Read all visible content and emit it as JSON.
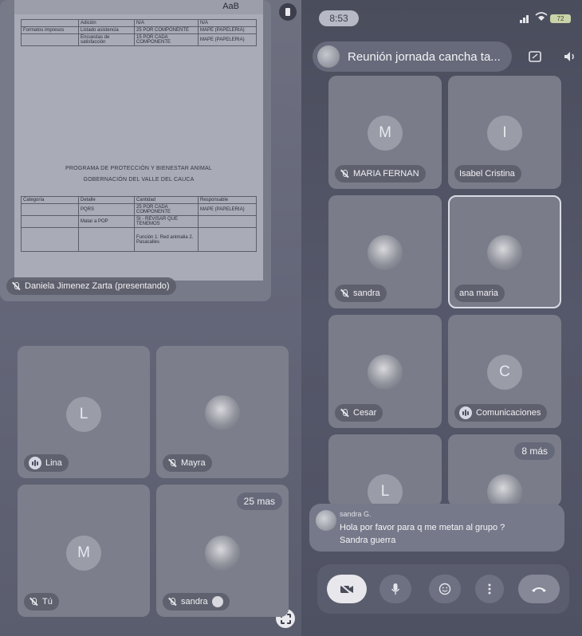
{
  "status_bar": {
    "time": "8:53",
    "battery": "72"
  },
  "meeting": {
    "title": "Reunión jornada cancha ta..."
  },
  "presentation": {
    "presenter_label": "Daniela Jimenez Zarta (presentando)",
    "doc": {
      "toolbar_text": "AaB",
      "top_rows": [
        [
          "",
          "Adición",
          "N/A",
          "N/A"
        ],
        [
          "Formatos impresos",
          "Listado asistencia",
          "25 POR COMPONENTE",
          "MAPE (PAPELERIA)"
        ],
        [
          "",
          "Encuestas de satisfacción",
          "15 POR CADA COMPONENTE",
          "MAPE (PAPELERIA)"
        ]
      ],
      "heading_1": "PROGRAMA DE PROTECCIÓN Y BIENESTAR ANIMAL",
      "heading_2": "GOBERNACIÓN DEL VALLE DEL CAUCA",
      "table_headers": [
        "Categoría",
        "Detalle",
        "Cantidad",
        "Responsable"
      ],
      "rows": [
        [
          "",
          "PQRS",
          "25 POR CADA COMPONENTE",
          "MAPE (PAPELERIA)"
        ],
        [
          "",
          "Matar a POP",
          "SI - REVISAR QUE TENEMOS",
          ""
        ],
        [
          "",
          "",
          "Función 1: Red animalia 2. Pasacalles",
          ""
        ]
      ]
    }
  },
  "left_tiles": [
    {
      "initial": "L",
      "name": "Lina",
      "state": "speaking"
    },
    {
      "initial": "",
      "name": "Mayra",
      "state": "muted"
    },
    {
      "initial": "M",
      "name": "Tú",
      "state": "muted"
    },
    {
      "initial": "",
      "name": "sandra",
      "state": "muted",
      "more": "25 mas"
    }
  ],
  "right_tiles": [
    {
      "initial": "M",
      "name": "MARIA FERNAN",
      "state": "muted"
    },
    {
      "initial": "I",
      "name": "Isabel Cristina",
      "state": "none"
    },
    {
      "initial": "",
      "name": "sandra",
      "state": "muted"
    },
    {
      "initial": "",
      "name": "ana maria",
      "state": "none"
    },
    {
      "initial": "",
      "name": "Cesar",
      "state": "muted"
    },
    {
      "initial": "C",
      "name": "Comunicaciones",
      "state": "speaking"
    },
    {
      "initial": "L",
      "name": "",
      "state": "none"
    },
    {
      "initial": "",
      "name": "",
      "state": "none",
      "more": "8 más"
    }
  ],
  "toast": {
    "sender": "sandra G.",
    "message": "Hola por favor para q me metan al grupo ?",
    "signature": "Sandra guerra"
  },
  "icons": {
    "signal": "signal-icon",
    "wifi": "wifi-icon",
    "screen": "screen-share-icon",
    "speaker": "speaker-icon",
    "camera_off": "camera-off-icon",
    "mic": "mic-icon",
    "emoji": "emoji-icon",
    "more": "more-vert-icon",
    "end_call": "end-call-icon"
  }
}
